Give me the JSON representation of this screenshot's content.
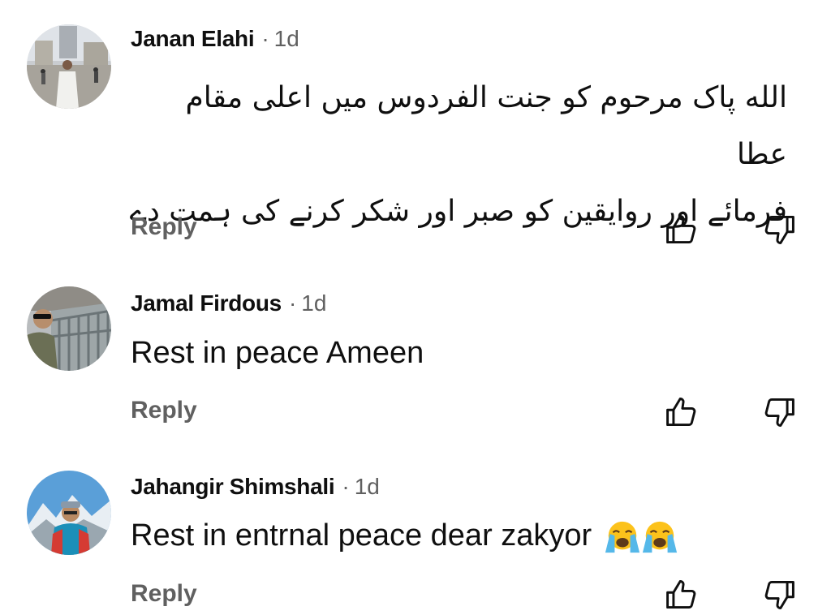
{
  "comments": [
    {
      "author": "Janan Elahi",
      "time": "1d",
      "text_line1": "الله پاک مرحوم کو جنت الفردوس میں اعلی مقام عطا",
      "text_line2": "فرمائے اور روایقین کو صبر اور شکر کرنے کی ہمت دے",
      "reply_label": "Reply",
      "avatar_icon": "avatar-photo-pilgrim"
    },
    {
      "author": "Jamal Firdous",
      "time": "1d",
      "text": "Rest in peace Ameen",
      "reply_label": "Reply",
      "avatar_icon": "avatar-photo-bridge"
    },
    {
      "author": "Jahangir Shimshali",
      "time": "1d",
      "text": "Rest in entrnal peace dear zakyor",
      "emoji": [
        "loudly-crying-face",
        "loudly-crying-face"
      ],
      "reply_label": "Reply",
      "avatar_icon": "avatar-photo-mountain"
    }
  ],
  "separator": "·",
  "colors": {
    "text_primary": "#0f0f0f",
    "text_secondary": "#606060",
    "background": "#ffffff"
  }
}
